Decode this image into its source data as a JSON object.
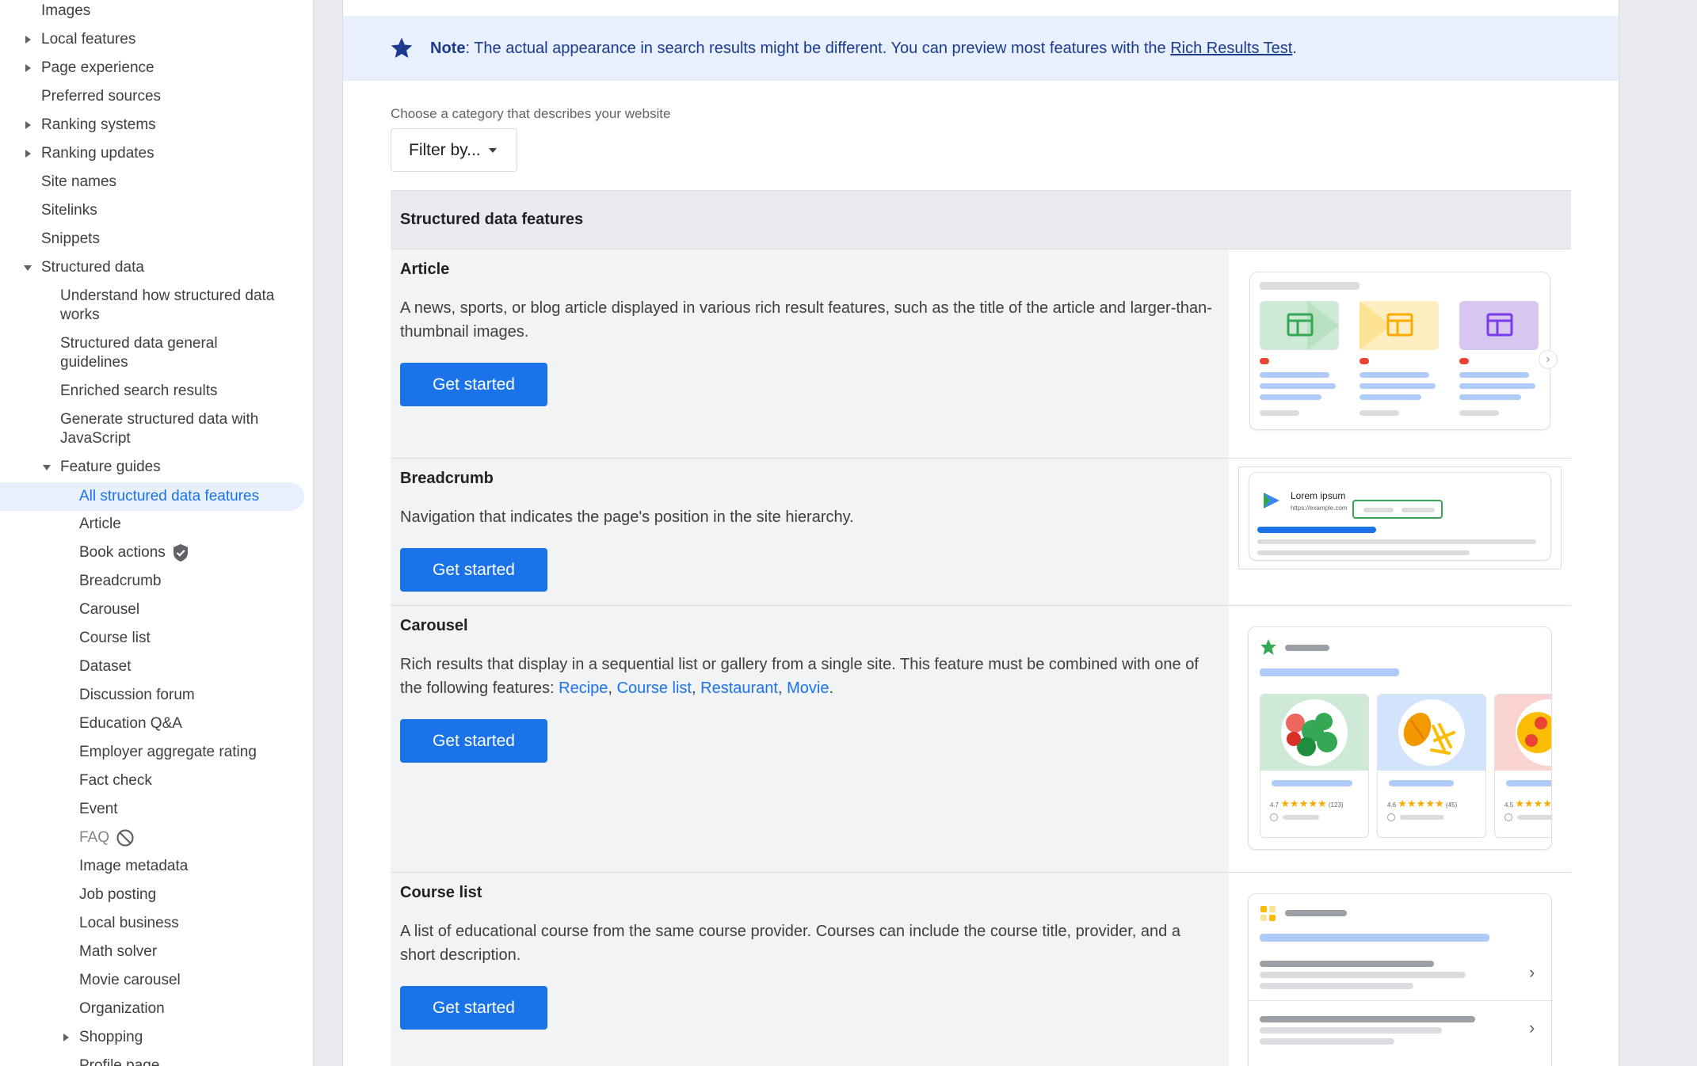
{
  "sidebar": {
    "items": [
      {
        "label": "Images"
      },
      {
        "label": "Local features"
      },
      {
        "label": "Page experience"
      },
      {
        "label": "Preferred sources"
      },
      {
        "label": "Ranking systems"
      },
      {
        "label": "Ranking updates"
      },
      {
        "label": "Site names"
      },
      {
        "label": "Sitelinks"
      },
      {
        "label": "Snippets"
      },
      {
        "label": "Structured data"
      },
      {
        "label": "Understand how structured data works"
      },
      {
        "label": "Structured data general guidelines"
      },
      {
        "label": "Enriched search results"
      },
      {
        "label": "Generate structured data with JavaScript"
      },
      {
        "label": "Feature guides"
      },
      {
        "label": "All structured data features"
      },
      {
        "label": "Article"
      },
      {
        "label": "Book actions"
      },
      {
        "label": "Breadcrumb"
      },
      {
        "label": "Carousel"
      },
      {
        "label": "Course list"
      },
      {
        "label": "Dataset"
      },
      {
        "label": "Discussion forum"
      },
      {
        "label": "Education Q&A"
      },
      {
        "label": "Employer aggregate rating"
      },
      {
        "label": "Fact check"
      },
      {
        "label": "Event"
      },
      {
        "label": "FAQ"
      },
      {
        "label": "Image metadata"
      },
      {
        "label": "Job posting"
      },
      {
        "label": "Local business"
      },
      {
        "label": "Math solver"
      },
      {
        "label": "Movie carousel"
      },
      {
        "label": "Organization"
      },
      {
        "label": "Shopping"
      },
      {
        "label": "Profile page"
      }
    ]
  },
  "note": {
    "label": "Note",
    "text": ": The actual appearance in search results might be different. You can preview most features with the ",
    "link": "Rich Results Test",
    "end": "."
  },
  "filter": {
    "label": "Choose a category that describes your website",
    "button": "Filter by..."
  },
  "table": {
    "header": "Structured data features",
    "rows": [
      {
        "title": "Article",
        "desc": "A news, sports, or blog article displayed in various rich result features, such as the title of the article and larger-than-thumbnail images.",
        "button": "Get started"
      },
      {
        "title": "Breadcrumb",
        "desc": "Navigation that indicates the page's position in the site hierarchy.",
        "button": "Get started",
        "preview_title": "Lorem ipsum",
        "preview_url": "https://example.com"
      },
      {
        "title": "Carousel",
        "desc_start": "Rich results that display in a sequential list or gallery from a single site. This feature must be combined with one of the following features: ",
        "links": [
          "Recipe",
          "Course list",
          "Restaurant",
          "Movie"
        ],
        "sep": ", ",
        "desc_end": ".",
        "button": "Get started",
        "ratings": [
          "4.7",
          "4.6",
          "4.5"
        ],
        "counts": [
          "(123)",
          "(45)"
        ]
      },
      {
        "title": "Course list",
        "desc": "A list of educational course from the same course provider. Courses can include the course title, provider, and a short description.",
        "button": "Get started"
      }
    ]
  },
  "colors": {
    "accent": "#1a73e8",
    "note_bg": "#e8f0fe",
    "note_text": "#1a3a8f"
  },
  "icons": {
    "note": "star-icon",
    "book_actions": "verified-shield-icon",
    "faq": "deprecated-icon"
  }
}
